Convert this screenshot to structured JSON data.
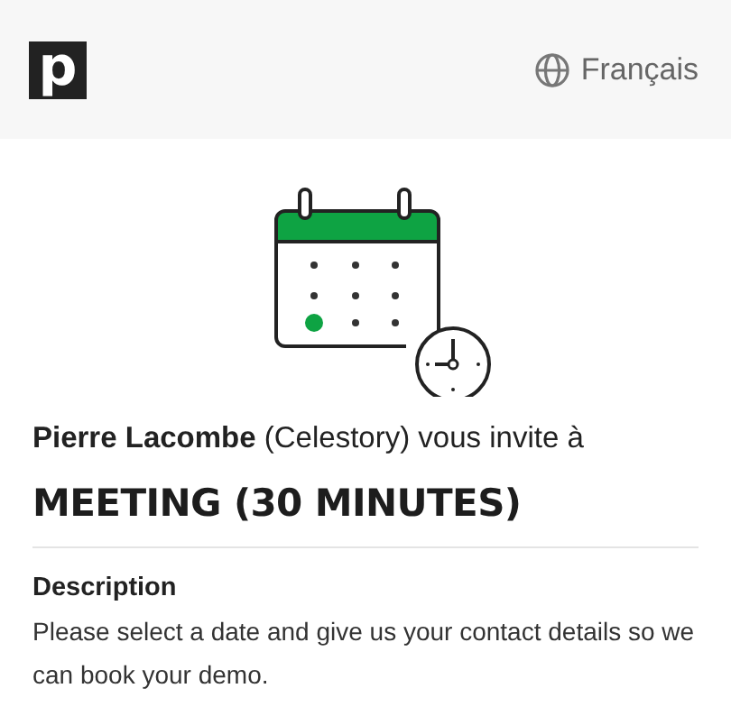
{
  "header": {
    "logo": "p",
    "language": "Français"
  },
  "invitation": "**Pierre Lacombe** (Celestory) vous invite à",
  "title": "MEETING (30 MINUTES)",
  "description": {
    "label": "Description",
    "text": "Please select a date and give us your contact details so we can book your demo."
  }
}
